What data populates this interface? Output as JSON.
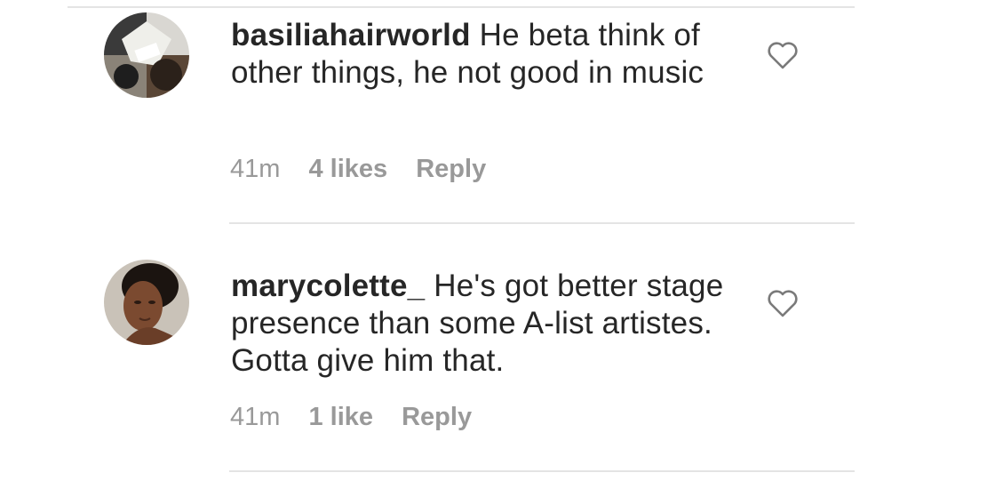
{
  "comments": [
    {
      "username": "basiliahairworld",
      "text": "He beta think of other things, he not good in music",
      "time": "41m",
      "likes": "4 likes",
      "reply_label": "Reply"
    },
    {
      "username": "marycolette_",
      "text": "He's got better stage presence than some A-list artistes. Gotta give him that.",
      "time": "41m",
      "likes": "1 like",
      "reply_label": "Reply"
    }
  ],
  "colors": {
    "text": "#262626",
    "meta": "#999999",
    "divider": "#e4e4e4",
    "heart": "#7a7a7a"
  },
  "icons": {
    "like": "heart-outline-icon"
  }
}
